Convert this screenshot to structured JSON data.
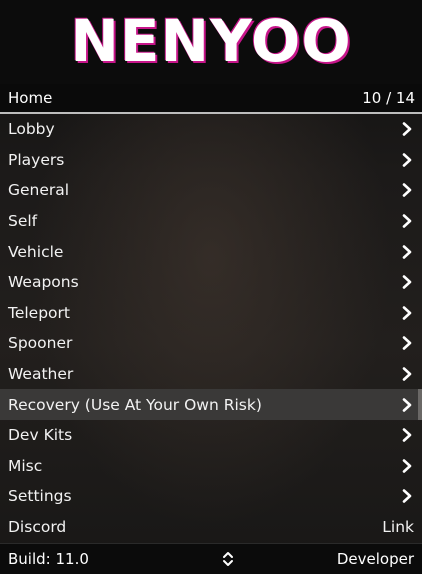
{
  "header": {
    "logo_text": "NENYOO"
  },
  "subheader": {
    "title": "Home",
    "counter": "10 / 14"
  },
  "items": [
    {
      "label": "Lobby",
      "right": "chevron"
    },
    {
      "label": "Players",
      "right": "chevron"
    },
    {
      "label": "General",
      "right": "chevron"
    },
    {
      "label": "Self",
      "right": "chevron"
    },
    {
      "label": "Vehicle",
      "right": "chevron"
    },
    {
      "label": "Weapons",
      "right": "chevron"
    },
    {
      "label": "Teleport",
      "right": "chevron"
    },
    {
      "label": "Spooner",
      "right": "chevron"
    },
    {
      "label": "Weather",
      "right": "chevron"
    },
    {
      "label": "Recovery (Use At Your Own Risk)",
      "right": "chevron",
      "selected": true
    },
    {
      "label": "Dev Kits",
      "right": "chevron"
    },
    {
      "label": "Misc",
      "right": "chevron"
    },
    {
      "label": "Settings",
      "right": "chevron"
    },
    {
      "label": "Discord",
      "right_text": "Link"
    }
  ],
  "footer": {
    "build": "Build: 11.0",
    "icon": "up-down-arrows-icon",
    "role": "Developer"
  },
  "colors": {
    "logo_shadow": "#c7158a",
    "selected_bg": "#3a3938",
    "text": "#f2f2f2"
  }
}
